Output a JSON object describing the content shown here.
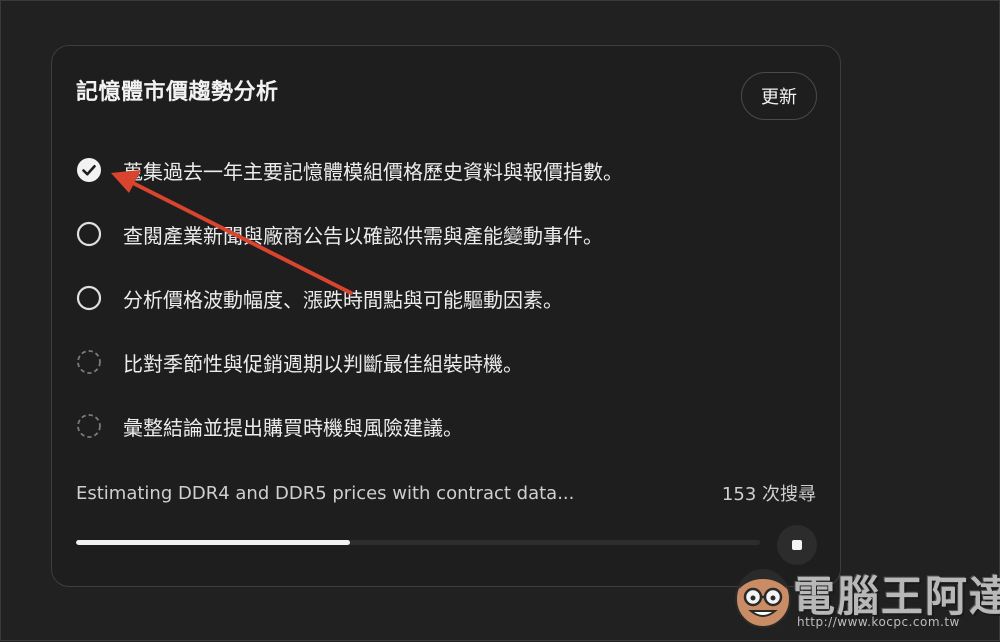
{
  "card": {
    "title": "記憶體市價趨勢分析",
    "update_label": "更新"
  },
  "steps": [
    {
      "text": "蒐集過去一年主要記憶體模組價格歷史資料與報價指數。",
      "state": "done",
      "icon": "check-circle-icon"
    },
    {
      "text": "查閱產業新聞與廠商公告以確認供需與產能變動事件。",
      "state": "pending",
      "icon": "circle-icon"
    },
    {
      "text": "分析價格波動幅度、漲跌時間點與可能驅動因素。",
      "state": "pending",
      "icon": "circle-icon"
    },
    {
      "text": "比對季節性與促銷週期以判斷最佳組裝時機。",
      "state": "queued",
      "icon": "dashed-circle-icon"
    },
    {
      "text": "彙整結論並提出購買時機與風險建議。",
      "state": "queued",
      "icon": "dashed-circle-icon"
    }
  ],
  "status": {
    "text": "Estimating DDR4 and DDR5 prices with contract data...",
    "search_count": "153 次搜尋",
    "progress": 0.4
  },
  "stop_icon": "stop-icon",
  "annotation_arrow_color": "#d9442f",
  "watermark": {
    "title": "電腦王阿達",
    "url": "http://www.kocpc.com.tw"
  }
}
